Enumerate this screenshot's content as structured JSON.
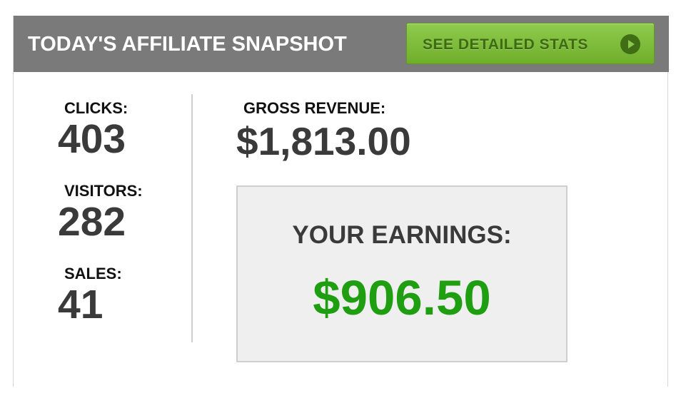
{
  "header": {
    "title": "TODAY'S AFFILIATE SNAPSHOT",
    "button_label": "SEE DETAILED STATS",
    "button_icon": "play-circle-icon"
  },
  "stats": {
    "clicks_label": "CLICKS:",
    "clicks_value": "403",
    "visitors_label": "VISITORS:",
    "visitors_value": "282",
    "sales_label": "SALES:",
    "sales_value": "41"
  },
  "revenue": {
    "gross_label": "GROSS REVENUE:",
    "gross_value": "$1,813.00"
  },
  "earnings": {
    "label": "YOUR EARNINGS:",
    "value": "$906.50"
  },
  "colors": {
    "header_bg": "#7a7a7a",
    "button_green": "#7dbd3a",
    "button_text": "#3e6b12",
    "earnings_green": "#1f9e12",
    "value_gray": "#3a3a3a"
  }
}
